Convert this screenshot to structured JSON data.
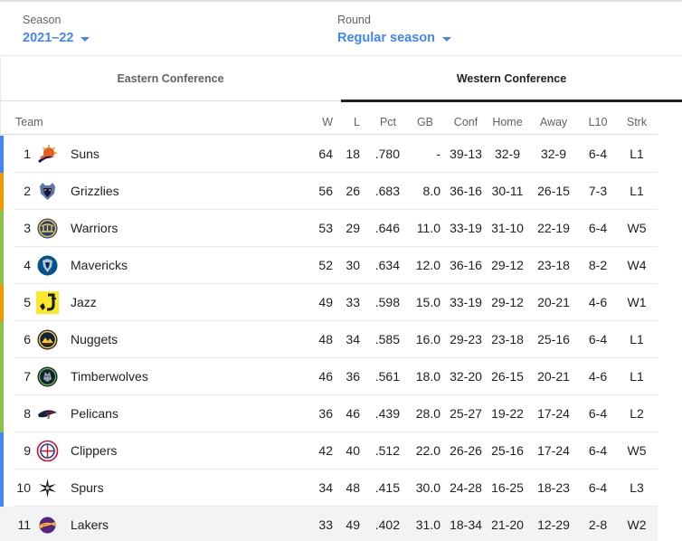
{
  "filters": {
    "season": {
      "label": "Season",
      "value": "2021–22"
    },
    "round": {
      "label": "Round",
      "value": "Regular season"
    }
  },
  "tabs": [
    {
      "label": "Eastern Conference",
      "selected": false
    },
    {
      "label": "Western Conference",
      "selected": true
    }
  ],
  "columns": {
    "team": "Team",
    "w": "W",
    "l": "L",
    "pct": "Pct",
    "gb": "GB",
    "conf": "Conf",
    "home": "Home",
    "away": "Away",
    "l10": "L10",
    "strk": "Strk"
  },
  "colors": {
    "blue": "#4285f4",
    "orange": "#f29900",
    "green": "#8bc34a"
  },
  "rows": [
    {
      "rank": "1",
      "team": "Suns",
      "logo": "suns-logo",
      "marker": "blue",
      "w": "64",
      "l": "18",
      "pct": ".780",
      "gb": "-",
      "conf": "39-13",
      "home": "32-9",
      "away": "32-9",
      "l10": "6-4",
      "strk": "L1"
    },
    {
      "rank": "2",
      "team": "Grizzlies",
      "logo": "grizzlies-logo",
      "marker": "orange",
      "w": "56",
      "l": "26",
      "pct": ".683",
      "gb": "8.0",
      "conf": "36-16",
      "home": "30-11",
      "away": "26-15",
      "l10": "7-3",
      "strk": "L1"
    },
    {
      "rank": "3",
      "team": "Warriors",
      "logo": "warriors-logo",
      "marker": "green",
      "w": "53",
      "l": "29",
      "pct": ".646",
      "gb": "11.0",
      "conf": "33-19",
      "home": "31-10",
      "away": "22-19",
      "l10": "6-4",
      "strk": "W5"
    },
    {
      "rank": "4",
      "team": "Mavericks",
      "logo": "mavericks-logo",
      "marker": "green",
      "w": "52",
      "l": "30",
      "pct": ".634",
      "gb": "12.0",
      "conf": "36-16",
      "home": "29-12",
      "away": "23-18",
      "l10": "8-2",
      "strk": "W4"
    },
    {
      "rank": "5",
      "team": "Jazz",
      "logo": "jazz-logo",
      "marker": "orange",
      "w": "49",
      "l": "33",
      "pct": ".598",
      "gb": "15.0",
      "conf": "33-19",
      "home": "29-12",
      "away": "20-21",
      "l10": "4-6",
      "strk": "W1"
    },
    {
      "rank": "6",
      "team": "Nuggets",
      "logo": "nuggets-logo",
      "marker": "green",
      "w": "48",
      "l": "34",
      "pct": ".585",
      "gb": "16.0",
      "conf": "29-23",
      "home": "23-18",
      "away": "25-16",
      "l10": "6-4",
      "strk": "L1"
    },
    {
      "rank": "7",
      "team": "Timberwolves",
      "logo": "timberwolves-logo",
      "marker": "green",
      "w": "46",
      "l": "36",
      "pct": ".561",
      "gb": "18.0",
      "conf": "32-20",
      "home": "26-15",
      "away": "20-21",
      "l10": "4-6",
      "strk": "L1"
    },
    {
      "rank": "8",
      "team": "Pelicans",
      "logo": "pelicans-logo",
      "marker": "green",
      "w": "36",
      "l": "46",
      "pct": ".439",
      "gb": "28.0",
      "conf": "25-27",
      "home": "19-22",
      "away": "17-24",
      "l10": "6-4",
      "strk": "L2"
    },
    {
      "rank": "9",
      "team": "Clippers",
      "logo": "clippers-logo",
      "marker": "blue",
      "w": "42",
      "l": "40",
      "pct": ".512",
      "gb": "22.0",
      "conf": "26-26",
      "home": "25-16",
      "away": "17-24",
      "l10": "6-4",
      "strk": "W5"
    },
    {
      "rank": "10",
      "team": "Spurs",
      "logo": "spurs-logo",
      "marker": "blue",
      "w": "34",
      "l": "48",
      "pct": ".415",
      "gb": "30.0",
      "conf": "24-28",
      "home": "16-25",
      "away": "18-23",
      "l10": "6-4",
      "strk": "L3"
    },
    {
      "rank": "11",
      "team": "Lakers",
      "logo": "lakers-logo",
      "marker": "none",
      "w": "33",
      "l": "49",
      "pct": ".402",
      "gb": "31.0",
      "conf": "18-34",
      "home": "21-20",
      "away": "12-29",
      "l10": "2-8",
      "strk": "W2",
      "highlighted": true
    }
  ]
}
